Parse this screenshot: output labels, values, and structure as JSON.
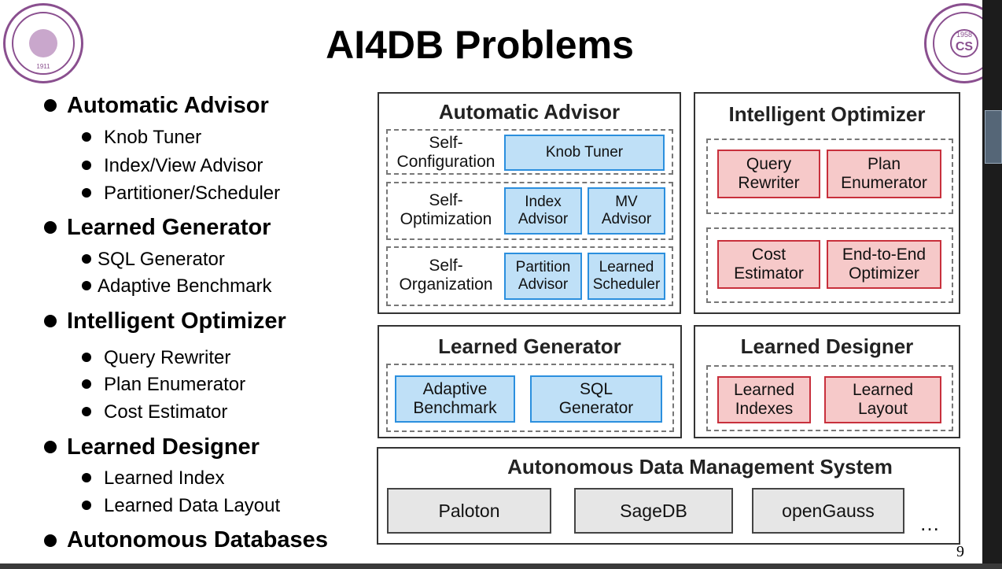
{
  "title": "AI4DB Problems",
  "page_number": "9",
  "outline": [
    {
      "label": "Automatic Advisor",
      "items": [
        "Knob Tuner",
        "Index/View Advisor",
        "Partitioner/Scheduler"
      ]
    },
    {
      "label": "Learned Generator",
      "items": [
        "SQL Generator",
        "Adaptive Benchmark"
      ]
    },
    {
      "label": "Intelligent Optimizer",
      "items": [
        "Query Rewriter",
        "Plan Enumerator",
        "Cost Estimator"
      ]
    },
    {
      "label": "Learned Designer",
      "items": [
        "Learned Index",
        "Learned Data Layout"
      ]
    },
    {
      "label": "Autonomous Databases",
      "items": []
    }
  ],
  "diagram": {
    "automatic_advisor": {
      "title": "Automatic Advisor",
      "rows": [
        {
          "label": "Self-\nConfiguration",
          "boxes": [
            "Knob Tuner"
          ]
        },
        {
          "label": "Self-\nOptimization",
          "boxes": [
            "Index\nAdvisor",
            "MV\nAdvisor"
          ]
        },
        {
          "label": "Self-\nOrganization",
          "boxes": [
            "Partition\nAdvisor",
            "Learned\nScheduler"
          ]
        }
      ]
    },
    "intelligent_optimizer": {
      "title": "Intelligent Optimizer",
      "boxes": [
        "Query\nRewriter",
        "Plan\nEnumerator",
        "Cost\nEstimator",
        "End-to-End\nOptimizer"
      ]
    },
    "learned_generator": {
      "title": "Learned Generator",
      "boxes": [
        "Adaptive\nBenchmark",
        "SQL\nGenerator"
      ]
    },
    "learned_designer": {
      "title": "Learned Designer",
      "boxes": [
        "Learned\nIndexes",
        "Learned\nLayout"
      ]
    },
    "adms": {
      "title": "Autonomous Data Management System",
      "systems": [
        "Paloton",
        "SageDB",
        "openGauss"
      ],
      "more": "…"
    }
  },
  "logos": {
    "left_year": "1911",
    "right_year": "1958",
    "right_text": "CS"
  },
  "colors": {
    "blue_fill": "#bfe0f7",
    "blue_border": "#2b8fde",
    "red_fill": "#f6c9c9",
    "red_border": "#c8303c",
    "logo_purple": "#8a4f8f"
  }
}
